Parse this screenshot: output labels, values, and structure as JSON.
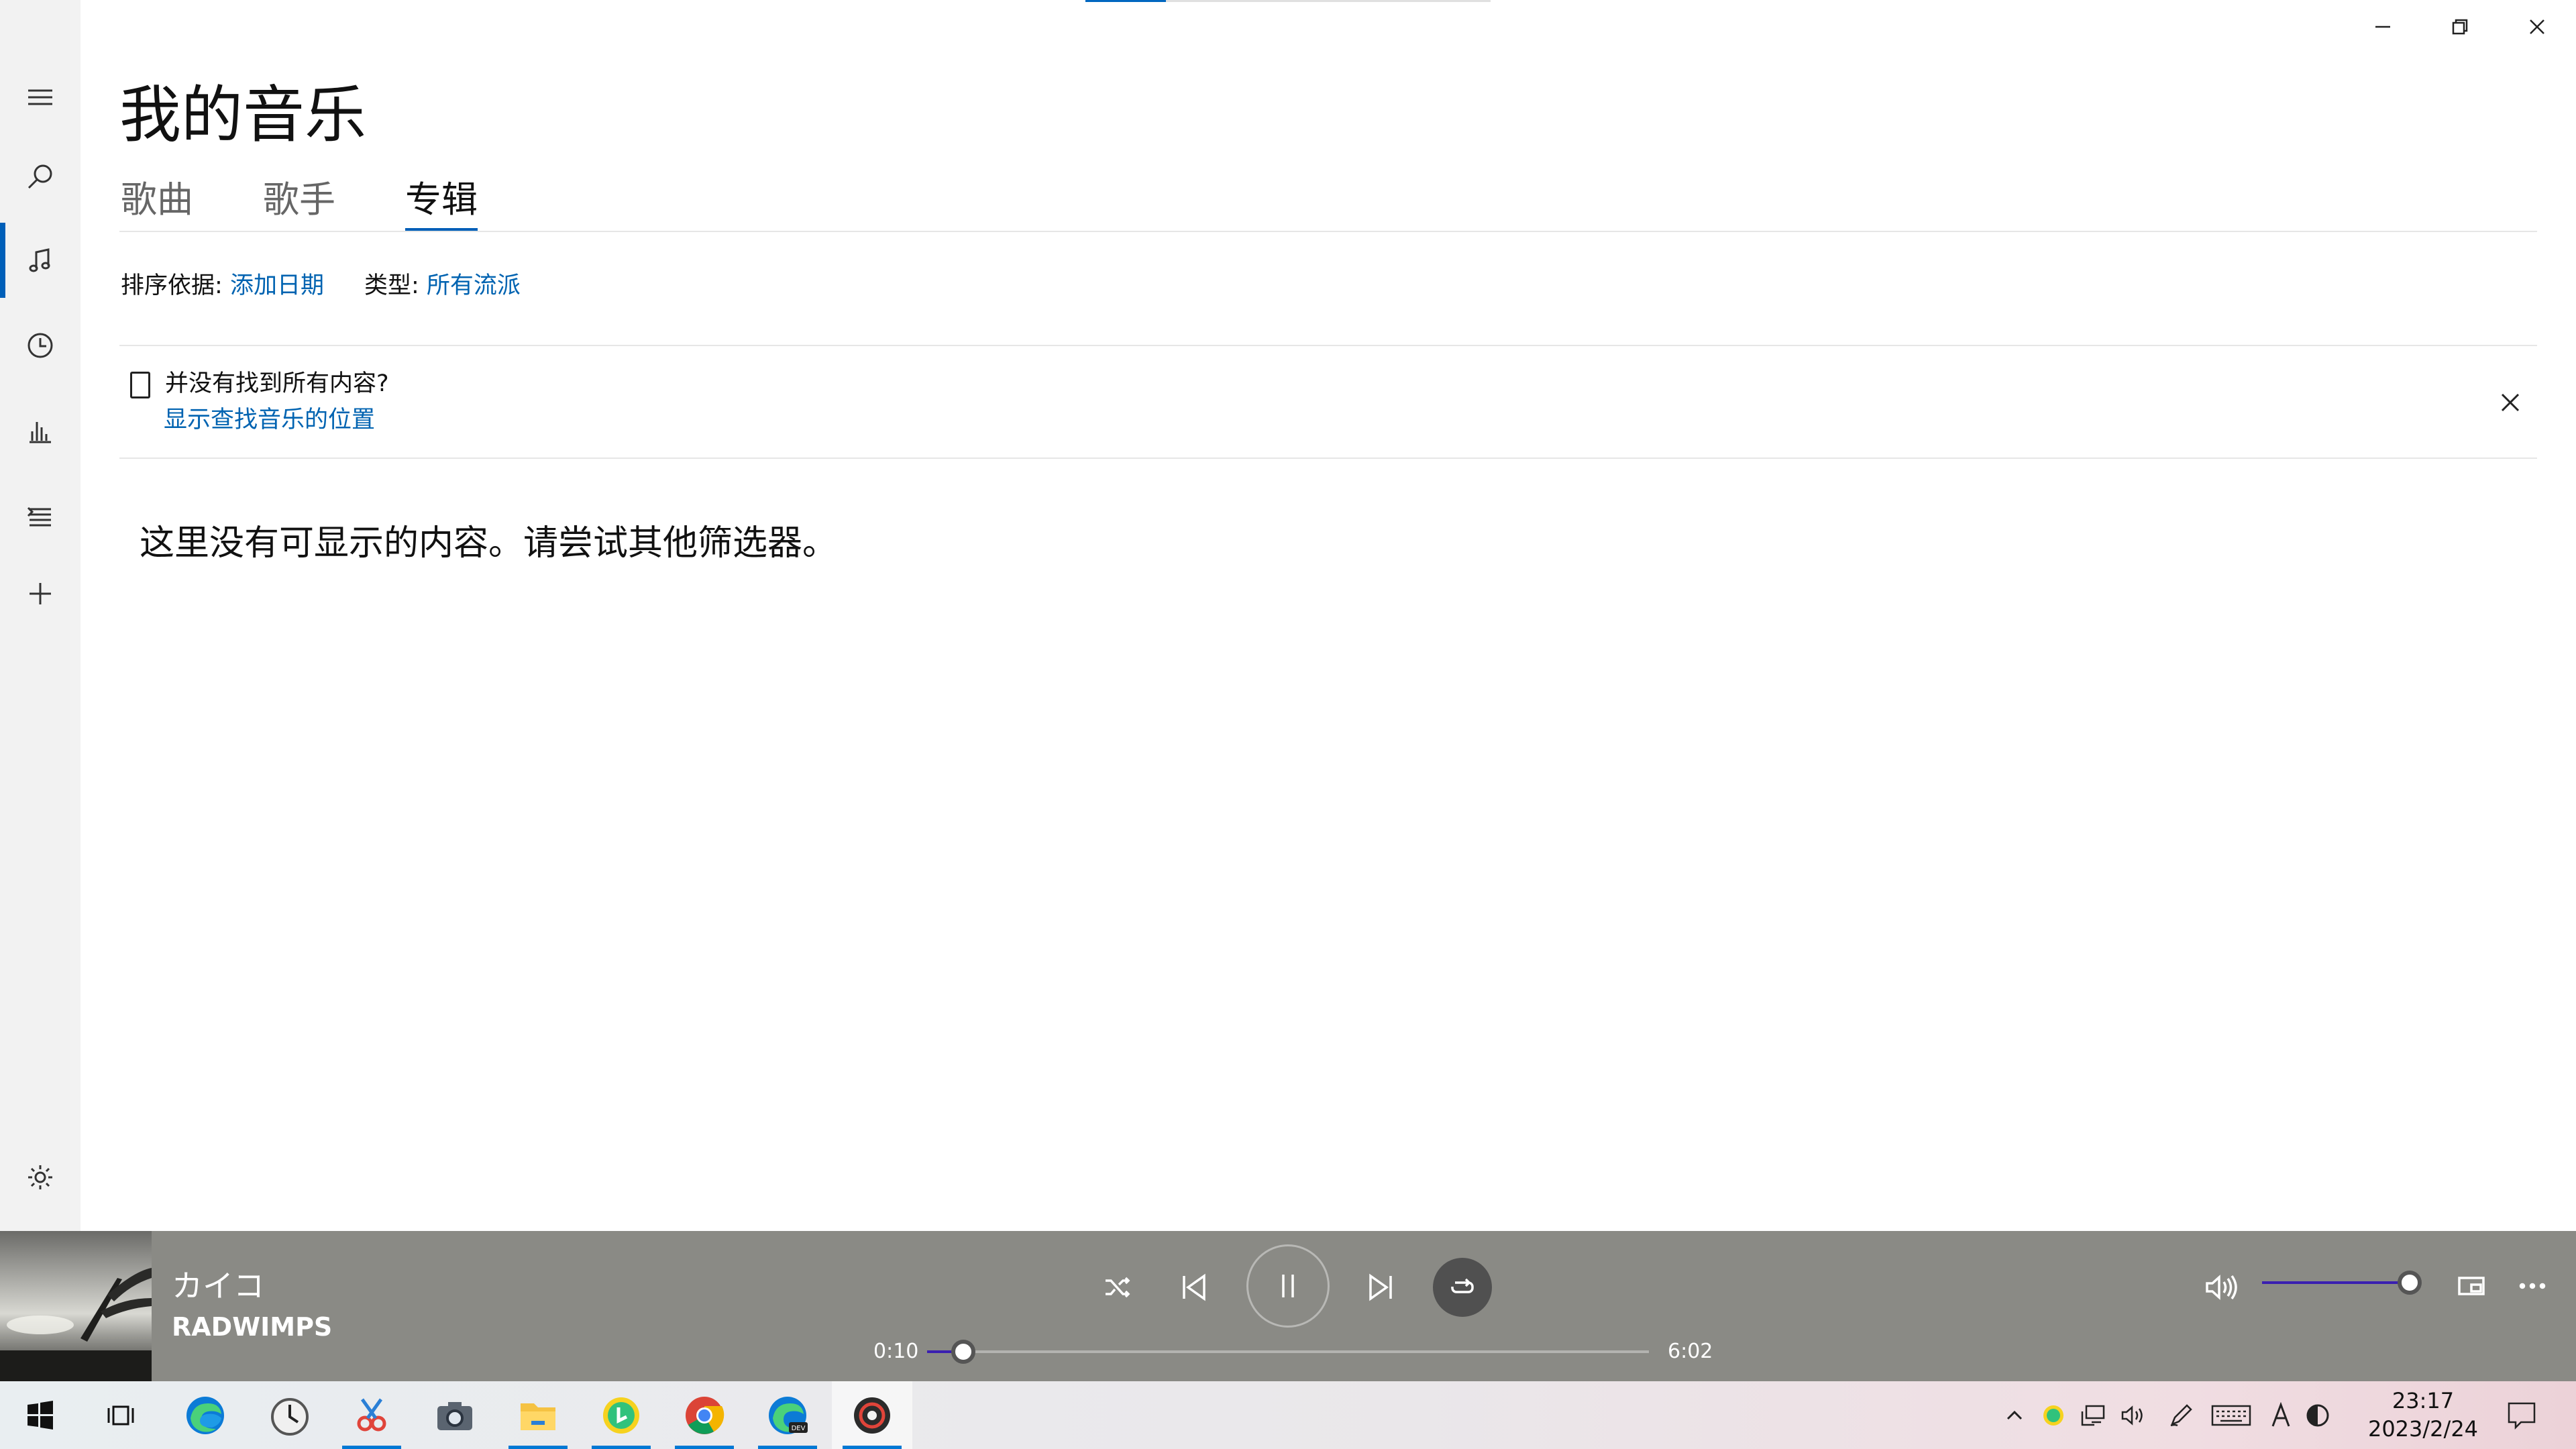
{
  "page": {
    "title": "我的音乐",
    "tabs": [
      {
        "label": "歌曲",
        "active": false
      },
      {
        "label": "歌手",
        "active": false
      },
      {
        "label": "专辑",
        "active": true
      }
    ]
  },
  "filters": {
    "sort_label": "排序依据:",
    "sort_value": "添加日期",
    "genre_label": "类型:",
    "genre_value": "所有流派"
  },
  "banner": {
    "title": "并没有找到所有内容?",
    "link": "显示查找音乐的位置"
  },
  "empty_message": "这里没有可显示的内容。请尝试其他筛选器。",
  "nav": {
    "items": [
      "menu-icon",
      "search-icon",
      "music-note-icon",
      "clock-icon",
      "bar-chart-icon",
      "playlist-icon",
      "plus-icon",
      "gear-icon"
    ],
    "active": "music-note-icon"
  },
  "player": {
    "track_title": "カイコ",
    "artist": "RADWIMPS",
    "elapsed": "0:10",
    "total": "6:02",
    "progress": 0.05,
    "volume": 1.0,
    "playing": true,
    "repeat_on": true
  },
  "taskbar": {
    "apps": [
      "windows-start-icon",
      "task-view-icon",
      "edge-icon",
      "clock-app-icon",
      "snip-icon",
      "camera-icon",
      "file-explorer-icon",
      "qq-music-icon",
      "chrome-icon",
      "edge-dev-icon",
      "groove-music-icon"
    ],
    "clock_time": "23:17",
    "clock_date": "2023/2/24"
  },
  "colors": {
    "accent": "#005fb8",
    "link": "#0063b1",
    "player_bg": "#8a8a85",
    "seek_fill": "#3a1fb0"
  }
}
